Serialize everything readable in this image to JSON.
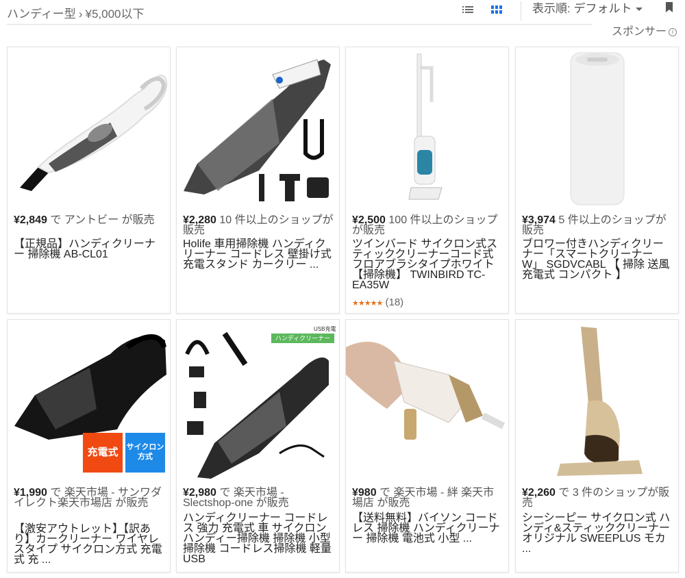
{
  "breadcrumb": {
    "category": "ハンディー型",
    "separator": "›",
    "filter": "¥5,000以下"
  },
  "toolbar": {
    "list_view_icon": "list-view-icon",
    "grid_view_icon": "grid-view-icon",
    "sort_label": "表示順: デフォルト",
    "bookmark_icon": "bookmark-icon",
    "sponsor_label": "スポンサー",
    "info_icon": "info-icon",
    "accent": "#1a73e8"
  },
  "products": [
    {
      "price": "¥2,849",
      "seller": "で アントビー が販売",
      "title": "【正規品】ハンディクリーナー 掃除機 AB-CL01"
    },
    {
      "price": "¥2,280",
      "seller": "10 件以上のショップが販売",
      "title": "Holife 車用掃除機 ハンディクリーナー コードレス 壁掛け式充電スタンド カークリー ..."
    },
    {
      "price": "¥2,500",
      "seller": "100 件以上のショップが販売",
      "title": "ツインバード サイクロン式スティッククリーナーコード式 フロアブラシタイプホワイト 【掃除機】 TWINBIRD TC-EA35W",
      "rating_count": "(18)",
      "rating": 4.5
    },
    {
      "price": "¥3,974",
      "seller": "5 件以上のショップが販売",
      "title": "ブロワー付きハンディクリーナー「スマートクリーナーW」 SGDVCABL 【 掃除 送風 充電式 コンパクト 】"
    },
    {
      "price": "¥1,990",
      "seller": "で 楽天市場 - サンワダイレクト楽天市場店 が販売",
      "title": "【激安アウトレット】【訳あり】カークリーナー ワイヤレスタイプ サイクロン方式 充電式 充 ...",
      "badge1": "充電式",
      "badge2": "サイクロン方式"
    },
    {
      "price": "¥2,980",
      "seller": "で 楽天市場 - Slectshop-one が販売",
      "title": "ハンディクリーナー コードレス 強力 充電式 車 サイクロン ハンディー掃除機 掃除機 小型掃除機 コードレス掃除機 軽量 USB",
      "badge_top": "USB充電",
      "badge_green": "ハンディクリーナー"
    },
    {
      "price": "¥980",
      "seller": "で 楽天市場 - 絆 楽天市場店 が販売",
      "title": "【送料無料】バイソン コードレス 掃除機 ハンディクリーナー 掃除機 電池式 小型 ..."
    },
    {
      "price": "¥2,260",
      "seller": "で 3 件のショップが販売",
      "title": "シーシーピー サイクロン式 ハンディ&スティッククリーナー オリジナル SWEEPLUS モカ ..."
    }
  ]
}
